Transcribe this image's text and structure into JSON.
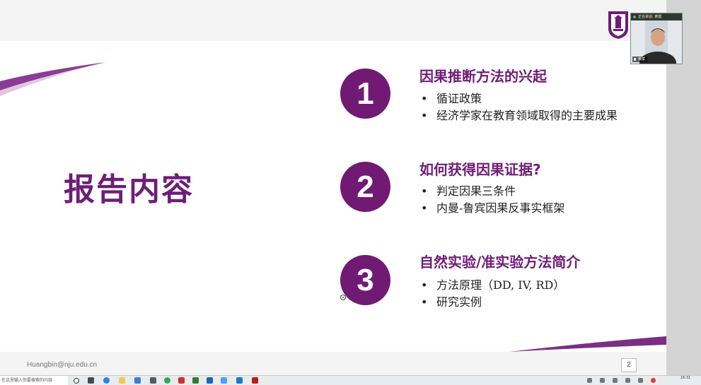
{
  "slide": {
    "title": "报告内容",
    "sections": [
      {
        "number": "1",
        "heading": "因果推断方法的兴起",
        "bullets": [
          "循证政策",
          "经济学家在教育领域取得的主要成果"
        ]
      },
      {
        "number": "2",
        "heading": "如何获得因果证据?",
        "bullets": [
          "判定因果三条件",
          "内曼-鲁宾因果反事实框架"
        ]
      },
      {
        "number": "3",
        "heading": "自然实验/准实验方法简介",
        "bullets": [
          "方法原理（DD, IV, RD）",
          "研究实例"
        ]
      }
    ],
    "bullet_char": "•",
    "footer_email": "Huangbin@nju.edu.cn",
    "page_number": "2"
  },
  "video": {
    "top_label": "正在讲话: 黄斌",
    "name": "黄斌"
  },
  "taskbar": {
    "search_placeholder": "在这里输入你要搜索的内容",
    "time": "16:31"
  },
  "colors": {
    "accent": "#6e1d76",
    "circle": "#701a74"
  }
}
